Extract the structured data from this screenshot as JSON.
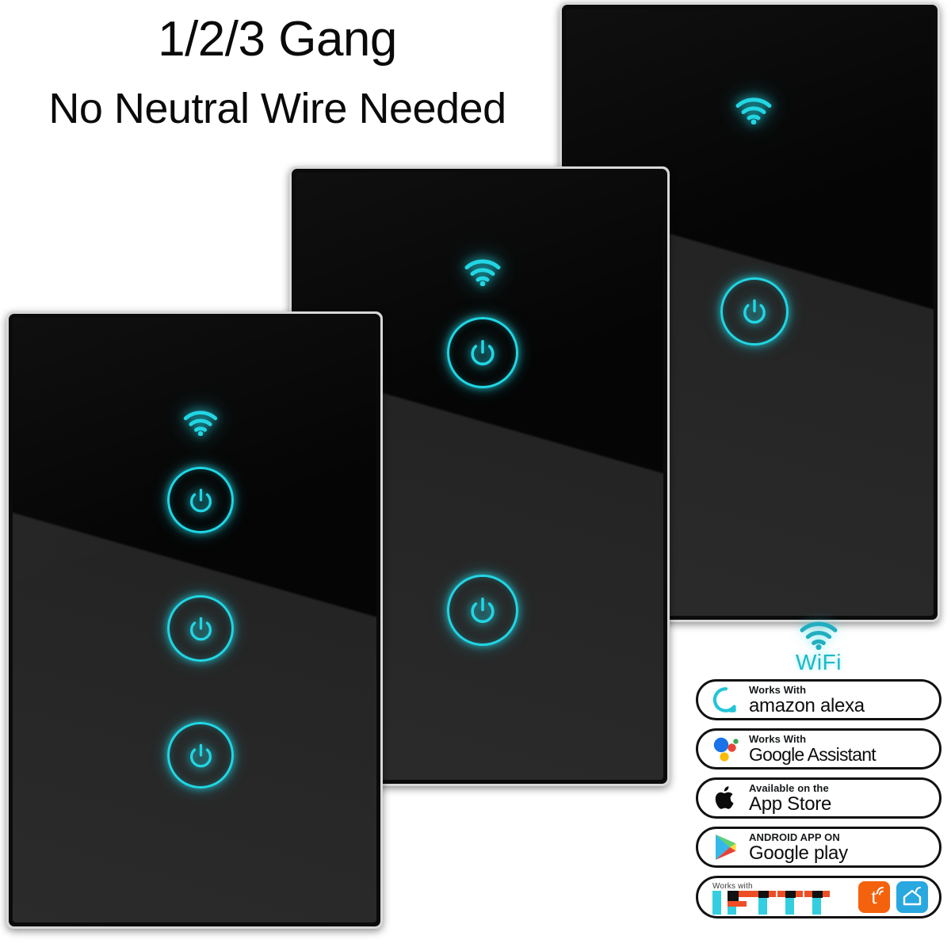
{
  "headline": {
    "line1": "1/2/3 Gang",
    "line2": "No Neutral Wire Needed"
  },
  "colors": {
    "accent_cyan": "#22d6e4",
    "panel_black": "#0b0b0b",
    "badge_border": "#111111",
    "tuya_orange": "#f4620d",
    "smartlife_blue": "#29a8e0",
    "ifttt_cyan": "#33cfe0",
    "ifttt_orange": "#ee4e25",
    "google_blue": "#1a73e8",
    "google_red": "#ea4335",
    "google_yellow": "#fbbc05",
    "google_green": "#34a853",
    "alexa_teal": "#21c6d6",
    "wifi_label": "#1db9c8"
  },
  "panels": [
    {
      "id": "panel-3gang",
      "name": "three-gang-switch-panel",
      "gang_count": 3,
      "wifi_icon": "wifi-icon",
      "buttons": [
        "power-icon",
        "power-icon",
        "power-icon"
      ]
    },
    {
      "id": "panel-2gang",
      "name": "two-gang-switch-panel",
      "gang_count": 2,
      "wifi_icon": "wifi-icon",
      "buttons": [
        "power-icon",
        "power-icon"
      ]
    },
    {
      "id": "panel-1gang",
      "name": "one-gang-switch-panel",
      "gang_count": 1,
      "wifi_icon": "wifi-icon",
      "buttons": [
        "power-icon"
      ]
    }
  ],
  "wifi_header": {
    "icon": "wifi-icon",
    "label": "WiFi"
  },
  "badges": [
    {
      "id": "alexa",
      "logo": "amazon-alexa-icon",
      "small": "Works With",
      "big": "amazon alexa"
    },
    {
      "id": "google-assistant",
      "logo": "google-assistant-icon",
      "small": "Works With",
      "big": "Google Assistant"
    },
    {
      "id": "app-store",
      "logo": "apple-icon",
      "small": "Available on the",
      "big": "App Store"
    },
    {
      "id": "google-play",
      "logo": "google-play-icon",
      "small": "ANDROID APP ON",
      "big": "Google play"
    }
  ],
  "ifttt_badge": {
    "small": "Works with",
    "wordmark": "IFTTT",
    "tuya_letter": "t",
    "tiles": [
      "tuya-icon",
      "smart-life-icon"
    ]
  }
}
